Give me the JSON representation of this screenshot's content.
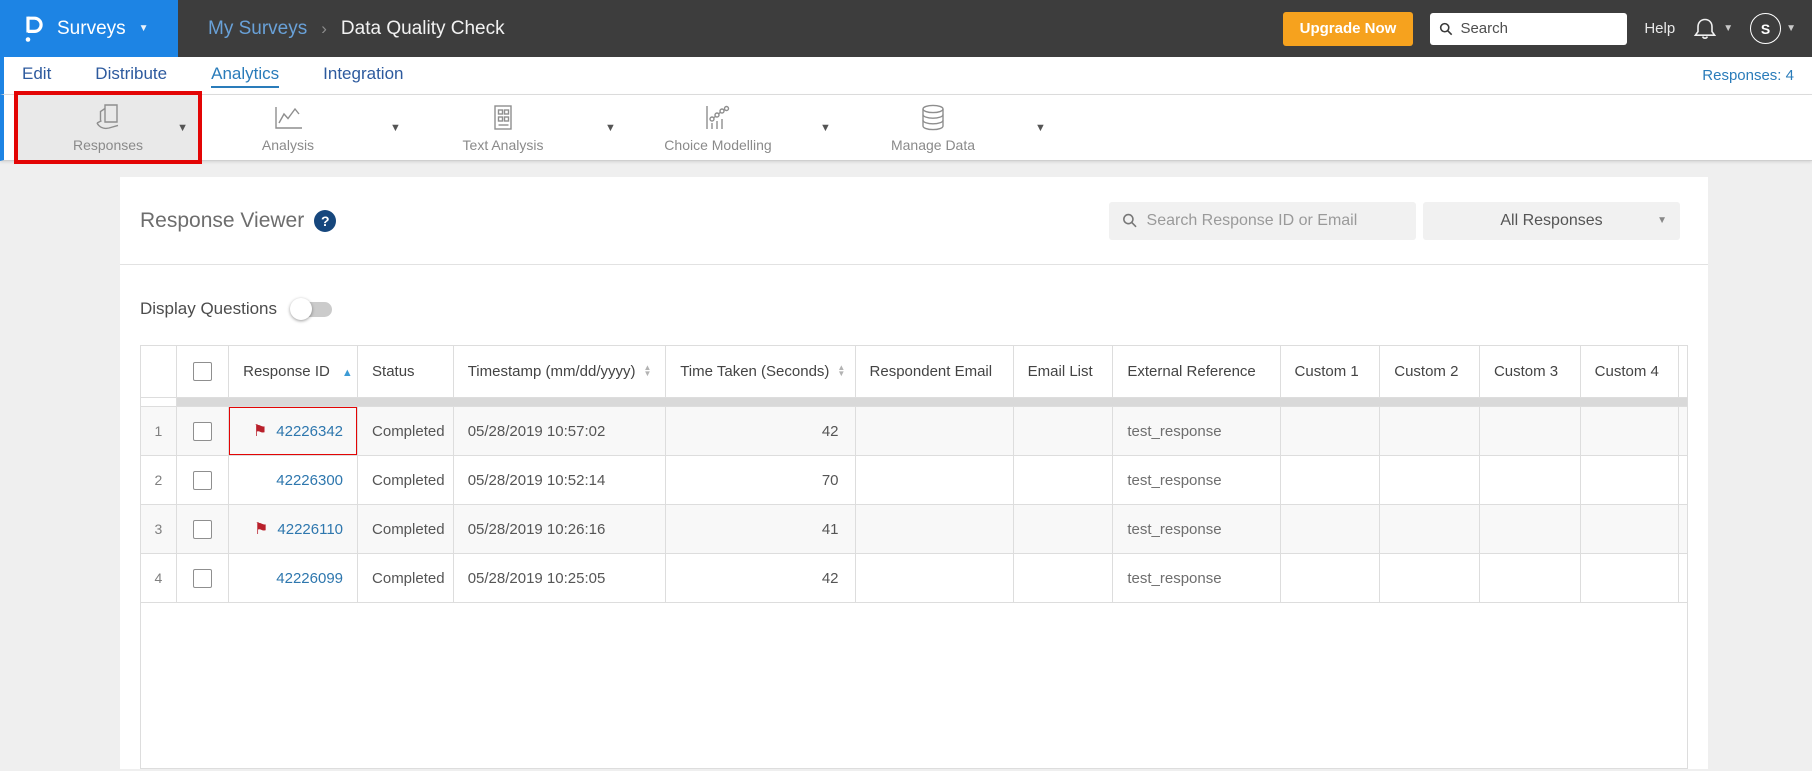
{
  "topbar": {
    "product_label": "Surveys",
    "breadcrumb": {
      "parent": "My Surveys",
      "separator": "›",
      "current": "Data Quality Check"
    },
    "upgrade_label": "Upgrade Now",
    "search_placeholder": "Search",
    "help_label": "Help",
    "avatar_initial": "S"
  },
  "nav": {
    "items": [
      {
        "label": "Edit"
      },
      {
        "label": "Distribute"
      },
      {
        "label": "Analytics",
        "active": true
      },
      {
        "label": "Integration"
      }
    ],
    "responses_count": "Responses: 4"
  },
  "toolbar": {
    "items": [
      {
        "label": "Responses",
        "icon": "responses-icon",
        "selected": true,
        "annotated": true
      },
      {
        "label": "Analysis",
        "icon": "analysis-icon"
      },
      {
        "label": "Text Analysis",
        "icon": "text-analysis-icon"
      },
      {
        "label": "Choice Modelling",
        "icon": "choice-modelling-icon"
      },
      {
        "label": "Manage Data",
        "icon": "manage-data-icon"
      }
    ]
  },
  "viewer": {
    "title": "Response Viewer",
    "help_badge": "?",
    "search_placeholder": "Search Response ID or Email",
    "filter_value": "All Responses",
    "display_questions_label": "Display Questions",
    "display_questions_state": "off"
  },
  "table": {
    "columns": [
      "",
      "",
      "Response ID",
      "Status",
      "Timestamp (mm/dd/yyyy)",
      "Time Taken (Seconds)",
      "Respondent Email",
      "Email List",
      "External Reference",
      "Custom 1",
      "Custom 2",
      "Custom 3",
      "Custom 4"
    ],
    "sort": {
      "column": "Response ID",
      "direction": "ascending"
    },
    "rows": [
      {
        "num": "1",
        "flagged": true,
        "annotated": true,
        "response_id": "42226342",
        "status": "Completed",
        "timestamp": "05/28/2019 10:57:02",
        "time_taken": "42",
        "respondent_email": "",
        "email_list": "",
        "external_reference": "test_response",
        "custom_1": "",
        "custom_2": "",
        "custom_3": "",
        "custom_4": ""
      },
      {
        "num": "2",
        "flagged": false,
        "annotated": false,
        "response_id": "42226300",
        "status": "Completed",
        "timestamp": "05/28/2019 10:52:14",
        "time_taken": "70",
        "respondent_email": "",
        "email_list": "",
        "external_reference": "test_response",
        "custom_1": "",
        "custom_2": "",
        "custom_3": "",
        "custom_4": ""
      },
      {
        "num": "3",
        "flagged": true,
        "annotated": false,
        "response_id": "42226110",
        "status": "Completed",
        "timestamp": "05/28/2019 10:26:16",
        "time_taken": "41",
        "respondent_email": "",
        "email_list": "",
        "external_reference": "test_response",
        "custom_1": "",
        "custom_2": "",
        "custom_3": "",
        "custom_4": ""
      },
      {
        "num": "4",
        "flagged": false,
        "annotated": false,
        "response_id": "42226099",
        "status": "Completed",
        "timestamp": "05/28/2019 10:25:05",
        "time_taken": "42",
        "respondent_email": "",
        "email_list": "",
        "external_reference": "test_response",
        "custom_1": "",
        "custom_2": "",
        "custom_3": "",
        "custom_4": ""
      }
    ]
  },
  "colors": {
    "brand_blue": "#1d84e4",
    "topbar_bg": "#3d3d3d",
    "upgrade_orange": "#f6a21e",
    "active_tab_blue": "#2a7cba",
    "nav_link_blue": "#2d5a9e",
    "link_blue": "#2e77ae",
    "flag_red": "#b9202b",
    "annotation_red": "#e30505",
    "page_bg": "#efefef",
    "table_border": "#dddddd",
    "zebra_row": "#f8f8f8"
  }
}
